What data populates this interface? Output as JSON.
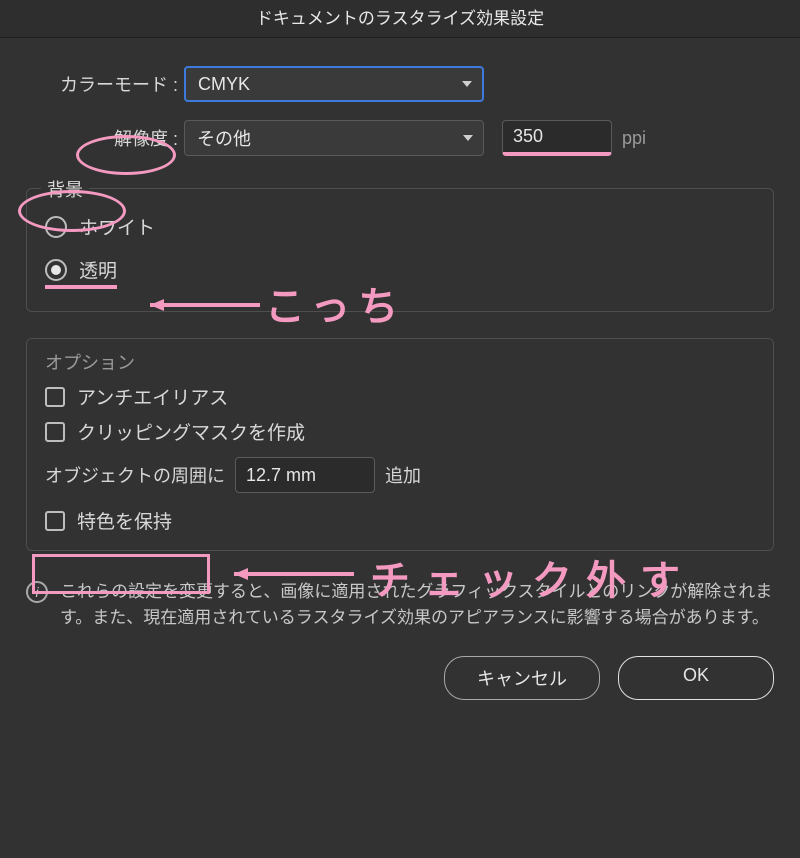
{
  "title": "ドキュメントのラスタライズ効果設定",
  "colorMode": {
    "label": "カラーモード :",
    "value": "CMYK"
  },
  "resolution": {
    "label": "解像度 :",
    "select": "その他",
    "value": "350",
    "unit": "ppi"
  },
  "background": {
    "legend": "背景",
    "white": "ホワイト",
    "transparent": "透明"
  },
  "options": {
    "title": "オプション",
    "antialias": "アンチエイリアス",
    "clipMask": "クリッピングマスクを作成",
    "offsetPrefix": "オブジェクトの周囲に",
    "offsetValue": "12.7 mm",
    "offsetSuffix": "追加",
    "preserveSpot": "特色を保持"
  },
  "info": "これらの設定を変更すると、画像に適用されたグラフィックスタイルとのリンクが解除されます。また、現在適用されているラスタライズ効果のアピアランスに影響する場合があります。",
  "buttons": {
    "cancel": "キャンセル",
    "ok": "OK"
  },
  "annotations": {
    "kocchi": "こっち",
    "checkOff": "チェック外す"
  }
}
